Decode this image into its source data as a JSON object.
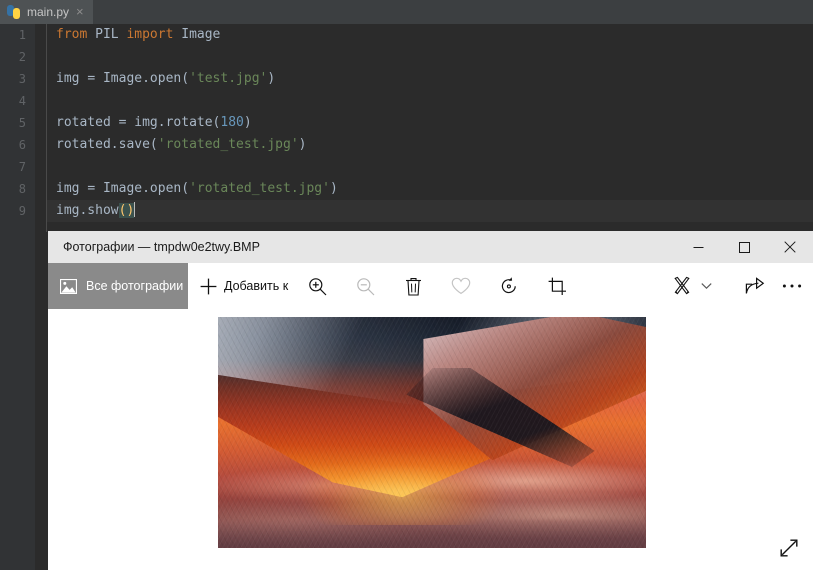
{
  "editor": {
    "tab": {
      "label": "main.py",
      "icon": "python-file-icon",
      "close_icon": "×"
    },
    "line_numbers": [
      "1",
      "2",
      "3",
      "4",
      "5",
      "6",
      "7",
      "8",
      "9"
    ],
    "code_lines": [
      {
        "n": "1",
        "tokens": [
          {
            "t": "from",
            "c": "kw"
          },
          {
            "t": " PIL ",
            "c": "id"
          },
          {
            "t": "import",
            "c": "kw"
          },
          {
            "t": " Image",
            "c": "cls"
          }
        ]
      },
      {
        "n": "2",
        "tokens": []
      },
      {
        "n": "3",
        "tokens": [
          {
            "t": "img ",
            "c": "id"
          },
          {
            "t": "= ",
            "c": "punct"
          },
          {
            "t": "Image",
            "c": "cls"
          },
          {
            "t": ".open(",
            "c": "punct"
          },
          {
            "t": "'test.jpg'",
            "c": "str"
          },
          {
            "t": ")",
            "c": "punct"
          }
        ]
      },
      {
        "n": "4",
        "tokens": []
      },
      {
        "n": "5",
        "tokens": [
          {
            "t": "rotated ",
            "c": "id"
          },
          {
            "t": "= ",
            "c": "punct"
          },
          {
            "t": "img",
            "c": "id"
          },
          {
            "t": ".rotate(",
            "c": "punct"
          },
          {
            "t": "180",
            "c": "num"
          },
          {
            "t": ")",
            "c": "punct"
          }
        ]
      },
      {
        "n": "6",
        "tokens": [
          {
            "t": "rotated",
            "c": "id"
          },
          {
            "t": ".save(",
            "c": "punct"
          },
          {
            "t": "'rotated_test.jpg'",
            "c": "str"
          },
          {
            "t": ")",
            "c": "punct"
          }
        ]
      },
      {
        "n": "7",
        "tokens": []
      },
      {
        "n": "8",
        "tokens": [
          {
            "t": "img ",
            "c": "id"
          },
          {
            "t": "= ",
            "c": "punct"
          },
          {
            "t": "Image",
            "c": "cls"
          },
          {
            "t": ".open(",
            "c": "punct"
          },
          {
            "t": "'rotated_test.jpg'",
            "c": "str"
          },
          {
            "t": ")",
            "c": "punct"
          }
        ]
      },
      {
        "n": "9",
        "active": true,
        "tokens": [
          {
            "t": "img",
            "c": "id"
          },
          {
            "t": ".show",
            "c": "punct"
          },
          {
            "t": "()",
            "c": "brhl"
          }
        ]
      }
    ],
    "plain_code": "from PIL import Image\n\nimg = Image.open('test.jpg')\n\nrotated = img.rotate(180)\nrotated.save('rotated_test.jpg')\n\nimg = Image.open('rotated_test.jpg')\nimg.show()",
    "colors": {
      "background": "#2b2b2b",
      "gutter": "#313335",
      "tabbar": "#3c3f41",
      "active_tab": "#4e5254",
      "keyword": "#cc7832",
      "string": "#6a8759",
      "number": "#6897bb",
      "identifier": "#a9b7c6",
      "line_number": "#606366",
      "bracket_match_bg": "#3b514d"
    }
  },
  "photos_window": {
    "title": "Фотографии — tmpdw0e2twy.BMP",
    "window_buttons": [
      {
        "name": "minimize",
        "glyph": "—"
      },
      {
        "name": "maximize",
        "glyph": "□"
      },
      {
        "name": "close",
        "glyph": "✕"
      }
    ],
    "toolbar": {
      "all_photos": {
        "label": "Все фотографии",
        "icon": "picture-icon",
        "active": true
      },
      "add_to": {
        "label": "Добавить к",
        "icon": "plus-icon"
      },
      "items": [
        {
          "name": "zoom-in",
          "icon": "magnifier-plus-icon",
          "enabled": true
        },
        {
          "name": "zoom-out",
          "icon": "magnifier-minus-icon",
          "enabled": false
        },
        {
          "name": "delete",
          "icon": "trash-icon",
          "enabled": true
        },
        {
          "name": "favorite",
          "icon": "heart-icon",
          "enabled": false
        },
        {
          "name": "rotate",
          "icon": "rotate-icon",
          "enabled": true
        },
        {
          "name": "crop",
          "icon": "crop-icon",
          "enabled": true
        },
        {
          "name": "edit-create",
          "icon": "pencils-icon",
          "enabled": true,
          "has_chevron": true
        },
        {
          "name": "share",
          "icon": "share-icon",
          "enabled": true
        },
        {
          "name": "more",
          "icon": "ellipsis-icon",
          "enabled": true
        }
      ]
    },
    "canvas": {
      "image_alt": "Фотография горы на закате, перевёрнутая на 180 градусов",
      "expand_icon": "expand-diagonal-icon"
    },
    "colors": {
      "titlebar": "#e6e6e6",
      "body": "#ffffff",
      "active_button": "#8a8a8a",
      "text": "#1a1a1a"
    }
  }
}
